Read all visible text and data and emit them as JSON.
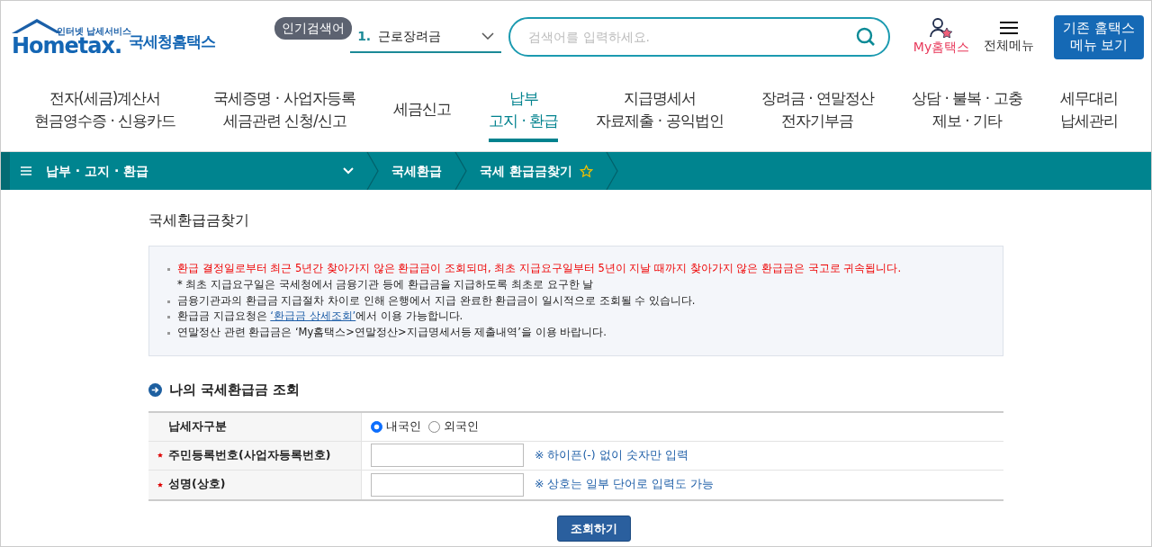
{
  "header": {
    "logo_tagline": "인터넷 납세서비스",
    "logo_brand": "Hometax.",
    "logo_name": "국세청홈택스",
    "popular_label": "인기검색어",
    "popular_rank": "1.",
    "popular_term": "근로장려금",
    "search_placeholder": "검색어를 입력하세요.",
    "my_link": "My홈택스",
    "menu_link": "전체메뉴",
    "classic_button": [
      "기존 홈택스",
      "메뉴 보기"
    ]
  },
  "nav": [
    {
      "lines": [
        "전자(세금)계산서",
        "현금영수증 · 신용카드"
      ],
      "selected": false
    },
    {
      "lines": [
        "국세증명 · 사업자등록",
        "세금관련 신청/신고"
      ],
      "selected": false
    },
    {
      "lines": [
        "세금신고"
      ],
      "selected": false
    },
    {
      "lines": [
        "납부",
        "고지 · 환급"
      ],
      "selected": true
    },
    {
      "lines": [
        "지급명세서",
        "자료제출 · 공익법인"
      ],
      "selected": false
    },
    {
      "lines": [
        "장려금 · 연말정산",
        "전자기부금"
      ],
      "selected": false
    },
    {
      "lines": [
        "상담 · 불복 · 고충",
        "제보 · 기타"
      ],
      "selected": false
    },
    {
      "lines": [
        "세무대리",
        "납세관리"
      ],
      "selected": false
    }
  ],
  "breadcrumb": [
    {
      "kind": "menu",
      "label": "납부 · 고지 · 환급"
    },
    {
      "kind": "crumb",
      "label": "국세환급"
    },
    {
      "kind": "crumb",
      "label": "국세 환급금찾기",
      "favorite": false
    }
  ],
  "page_title": "국세환급금찾기",
  "notices": [
    {
      "kind": "alert",
      "text": "환급 결정일로부터 최근 5년간 찾아가지 않은 환급금이 조회되며, 최초 지급요구일부터 5년이 지날 때까지 찾아가지 않은 환급금은 국고로 귀속됩니다."
    },
    {
      "kind": "sub",
      "text": "* 최초 지급요구일은 국세청에서 금융기관 등에 환급금을 지급하도록 최초로 요구한 날"
    },
    {
      "kind": "plain",
      "text": "금융기관과의 환급금 지급절차 차이로 인해 은행에서 지급 완료한 환급금이 일시적으로 조회될 수 있습니다."
    },
    {
      "kind": "link",
      "before": "환급금 지급요청은 ",
      "link": "‘환급금 상세조회’",
      "after": "에서 이용 가능합니다."
    },
    {
      "kind": "plain",
      "text": "연말정산 관련 환급금은 ‘My홈택스>연말정산>지급명세서등 제출내역’을 이용 바랍니다."
    }
  ],
  "section_title": "나의 국세환급금 조회",
  "form": [
    {
      "kind": "radio",
      "label": "납세자구분",
      "required": false,
      "options": [
        {
          "label": "내국인",
          "selected": true
        },
        {
          "label": "외국인",
          "selected": false
        }
      ]
    },
    {
      "kind": "input",
      "label": "주민등록번호(사업자등록번호)",
      "required": true,
      "hint": "※ 하이픈(-) 없이 숫자만 입력"
    },
    {
      "kind": "input",
      "label": "성명(상호)",
      "required": true,
      "hint": "※ 상호는 일부 단어로 입력도 가능"
    }
  ],
  "submit": "조회하기"
}
